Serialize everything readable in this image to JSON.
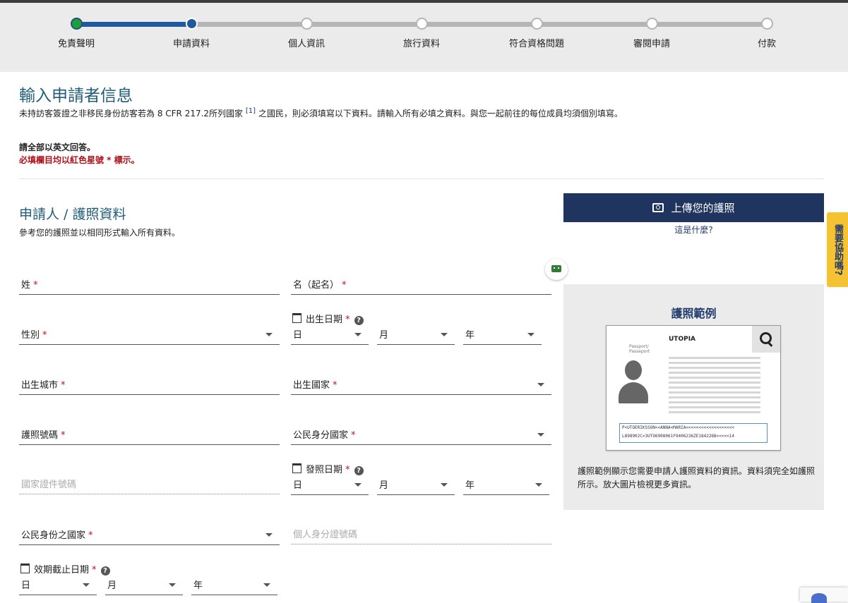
{
  "steps": [
    "免責聲明",
    "申請資料",
    "個人資訊",
    "旅行資料",
    "符合資格問題",
    "審閱申請",
    "付款"
  ],
  "heading": "輸入申請者信息",
  "intro": {
    "text1": "未持訪客簽證之非移民身份訪客若為 8 CFR 217.2所列國家 ",
    "sup": "[1]",
    "text2": " 之國民，則必須填寫以下資料。請輸入所有必填之資料。與您一起前往的每位成員均須個別填寫。"
  },
  "req_english": "請全部以英文回答。",
  "req_star": "必填欄目均以紅色星號 * 標示。",
  "section_title": "申請人 / 護照資料",
  "section_sub": "參考您的護照並以相同形式輸入所有資料。",
  "star": "*",
  "fields": {
    "surname": "姓",
    "given": "名（起名）",
    "gender": "性別",
    "dob": "出生日期",
    "birth_city": "出生城市",
    "birth_country": "出生國家",
    "passport_no": "護照號碼",
    "citizen_country": "公民身分國家",
    "national_id": "國家證件號碼",
    "issue_date": "發照日期",
    "citizen_of": "公民身份之國家",
    "personal_id": "個人身分證號碼",
    "expiry_date": "效期截止日期"
  },
  "date_parts": {
    "day": "日",
    "month": "月",
    "year": "年"
  },
  "help_glyph": "?",
  "upload_label": "上傳您的護照",
  "what_is": "這是什麼?",
  "example": {
    "title": "護照範例",
    "country": "UTOPIA",
    "passport_label": "Passport/\nPasseport",
    "mrz1": "P<UTOERIKSSON<<ANNA<MARIA<<<<<<<<<<<<<<<<<<<",
    "mrz2": "L898902C<3UTO6908061F9406236ZE184226B<<<<<14",
    "caption": "護照範例顯示您需要申請人護照資料的資訊。資料須完全如護照所示。放大圖片檢視更多資訊。"
  },
  "help_tab": "需要協助嗎?"
}
